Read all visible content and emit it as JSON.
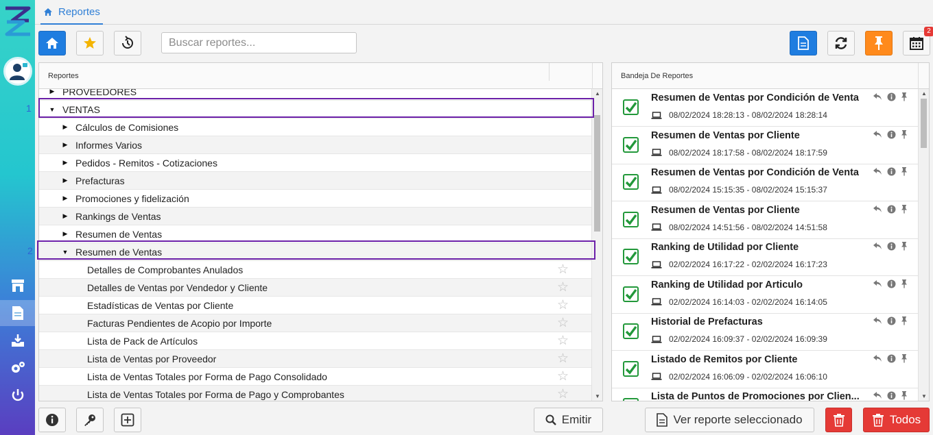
{
  "tab": {
    "label": "Reportes"
  },
  "search": {
    "placeholder": "Buscar reportes..."
  },
  "toolbar": {
    "calendar_badge": "2"
  },
  "left_panel": {
    "header": "Reportes",
    "rows": [
      {
        "label": "PROVEEDORES",
        "level": 1,
        "caret": "right",
        "star": false
      },
      {
        "label": "VENTAS",
        "level": 1,
        "caret": "down",
        "star": false
      },
      {
        "label": "Cálculos de Comisiones",
        "level": 2,
        "caret": "right",
        "star": false
      },
      {
        "label": "Informes Varios",
        "level": 2,
        "caret": "right",
        "star": false
      },
      {
        "label": "Pedidos - Remitos - Cotizaciones",
        "level": 2,
        "caret": "right",
        "star": false
      },
      {
        "label": "Prefacturas",
        "level": 2,
        "caret": "right",
        "star": false
      },
      {
        "label": "Promociones y fidelización",
        "level": 2,
        "caret": "right",
        "star": false
      },
      {
        "label": "Rankings de Ventas",
        "level": 2,
        "caret": "right",
        "star": false
      },
      {
        "label": "Resumen de Ventas",
        "level": 2,
        "caret": "right",
        "star": false
      },
      {
        "label": "Resumen de Ventas",
        "level": 2,
        "caret": "down",
        "star": false
      },
      {
        "label": "Detalles de Comprobantes Anulados",
        "level": 3,
        "caret": "",
        "star": true
      },
      {
        "label": "Detalles de Ventas por Vendedor y Cliente",
        "level": 3,
        "caret": "",
        "star": true
      },
      {
        "label": "Estadísticas de Ventas por Cliente",
        "level": 3,
        "caret": "",
        "star": true
      },
      {
        "label": "Facturas Pendientes de Acopio por Importe",
        "level": 3,
        "caret": "",
        "star": true
      },
      {
        "label": "Lista de Pack de Artículos",
        "level": 3,
        "caret": "",
        "star": true
      },
      {
        "label": "Lista de Ventas por Proveedor",
        "level": 3,
        "caret": "",
        "star": true
      },
      {
        "label": "Lista de Ventas Totales por Forma de Pago Consolidado",
        "level": 3,
        "caret": "",
        "star": true
      },
      {
        "label": "Lista de Ventas Totales por Forma de Pago y Comprobantes",
        "level": 3,
        "caret": "",
        "star": true
      }
    ],
    "annotation_1": "1",
    "annotation_2": "2"
  },
  "right_panel": {
    "header": "Bandeja De Reportes",
    "items": [
      {
        "title": "Resumen de Ventas por Condición de Venta",
        "range": "08/02/2024 18:28:13 - 08/02/2024 18:28:14"
      },
      {
        "title": "Resumen de Ventas por Cliente",
        "range": "08/02/2024 18:17:58 - 08/02/2024 18:17:59"
      },
      {
        "title": "Resumen de Ventas por Condición de Venta",
        "range": "08/02/2024 15:15:35 - 08/02/2024 15:15:37"
      },
      {
        "title": "Resumen de Ventas por Cliente",
        "range": "08/02/2024 14:51:56 - 08/02/2024 14:51:58"
      },
      {
        "title": "Ranking de Utilidad por Cliente",
        "range": "02/02/2024 16:17:22 - 02/02/2024 16:17:23"
      },
      {
        "title": "Ranking de Utilidad por Articulo",
        "range": "02/02/2024 16:14:03 - 02/02/2024 16:14:05"
      },
      {
        "title": "Historial de Prefacturas",
        "range": "02/02/2024 16:09:37 - 02/02/2024 16:09:39"
      },
      {
        "title": "Listado de Remitos por Cliente",
        "range": "02/02/2024 16:06:09 - 02/02/2024 16:06:10"
      },
      {
        "title": "Lista de Puntos de Promociones por Clien...",
        "range": ""
      }
    ]
  },
  "bottom": {
    "emitir_label": "Emitir",
    "ver_label": "Ver reporte seleccionado",
    "todos_label": "Todos"
  },
  "colors": {
    "accent": "#1f7de0",
    "selection": "#6b1fa8",
    "success": "#22983a",
    "danger": "#e53a36",
    "pin": "#ff8a1c"
  }
}
